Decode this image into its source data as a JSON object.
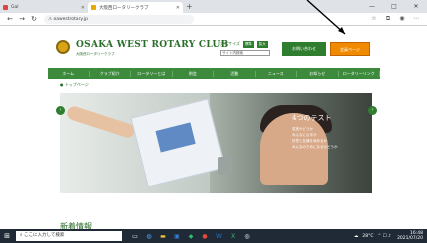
{
  "browser": {
    "tabs": [
      {
        "label": "Gal"
      },
      {
        "label": "大阪西ロータリークラブ"
      }
    ],
    "new_tab": "+",
    "window_controls": [
      "—",
      "□",
      "✕"
    ],
    "url": "oawestrotary.jp"
  },
  "site": {
    "club_name": "OSAKA WEST ROTARY CLUB",
    "club_subtitle": "大阪西ロータリークラブ",
    "font_size_label": "文字サイズ",
    "font_size_options": [
      "標準",
      "拡大"
    ],
    "search_placeholder": "サイト内検索",
    "contact_button": "お問い合わせ",
    "member_button": "会員ページ",
    "nav": [
      "ホーム",
      "クラブ紹介",
      "ロータリーとは",
      "例会",
      "活動",
      "ニュース",
      "お知らせ",
      "ロータリーリンク"
    ],
    "breadcrumb": "トップページ",
    "hero_title": "4つのテスト",
    "hero_lines": [
      "真実かどうか",
      "みんなに公平か",
      "好意と友情を深めるか",
      "みんなのためになるかどうか"
    ],
    "news_heading": "新着情報"
  },
  "taskbar": {
    "search_text": "ここに入力して検索",
    "weather": "28°C",
    "time": "16:48",
    "date": "2021/07/20"
  }
}
